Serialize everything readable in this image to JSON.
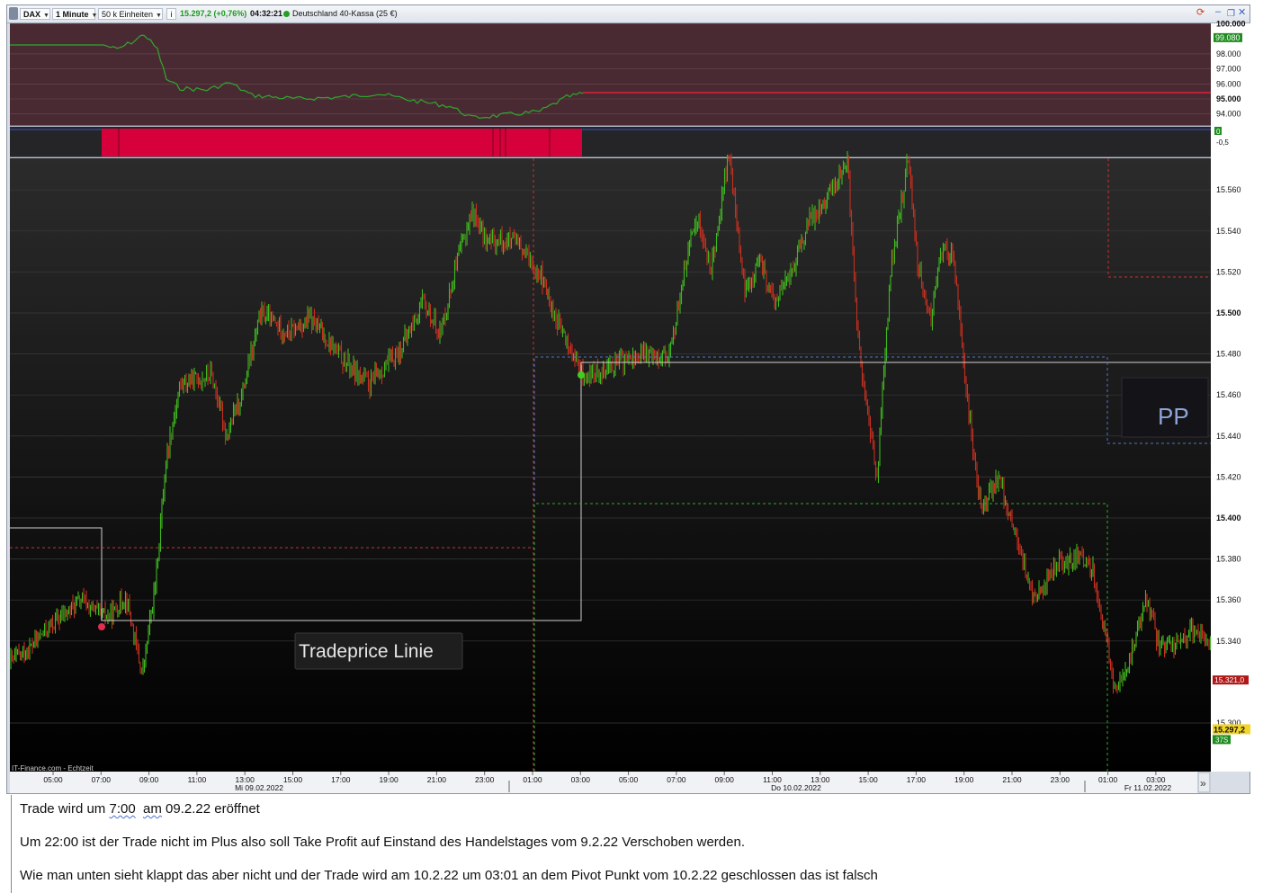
{
  "toolbar": {
    "instrument": "DAX",
    "timeframe": "1 Minute",
    "units": "50 k Einheiten",
    "price_change": "15.297,2 (+0,76%)",
    "time": "04:32:21",
    "market_name": "Deutschland 40-Kassa (25 €)"
  },
  "top_panel": {
    "ticks": [
      "100.000",
      "98.000",
      "97.000",
      "96.000",
      "95.000",
      "94.000"
    ],
    "current_label": "99.080",
    "colors": {
      "background": "#4a2a32",
      "line_flat": "#2ea82e",
      "line_level": "#e0203a",
      "current_label_bg": "#1e8c1e"
    }
  },
  "signal_panel": {
    "ticks": [
      "0",
      "-0,5"
    ],
    "colors": {
      "bar": "#d6003a",
      "line": "#3b4fd8"
    }
  },
  "main_chart": {
    "price_ticks": [
      "15.560",
      "15.540",
      "15.520",
      "15.500",
      "15.480",
      "15.460",
      "15.440",
      "15.420",
      "15.400",
      "15.380",
      "15.360",
      "15.340",
      "15.300"
    ],
    "bold_ticks": [
      "15.500",
      "15.400"
    ],
    "price_markers": {
      "red": "15.321,0",
      "current": "15.297,2",
      "countdown": "37S"
    },
    "time_labels": [
      "05:00",
      "07:00",
      "09:00",
      "11:00",
      "13:00",
      "15:00",
      "17:00",
      "19:00",
      "21:00",
      "23:00",
      "01:00",
      "03:00",
      "05:00",
      "07:00",
      "09:00",
      "11:00",
      "13:00",
      "15:00",
      "17:00",
      "19:00",
      "21:00",
      "23:00",
      "01:00",
      "03:00"
    ],
    "date_labels": [
      "Mi 09.02.2022",
      "Do 10.02.2022",
      "Fr 11.02.2022"
    ],
    "source_label": "IT-Finance.com - Echtzeit",
    "annotation_tradeprice": "Tradeprice Linie",
    "annotation_pp": "PP",
    "scroll_button": "»",
    "colors": {
      "background_top": "#2a2a2a",
      "background_bottom": "#000000",
      "candle_up": "#3fb81e",
      "candle_down": "#c43020",
      "red_dashed": "#c83232",
      "blue_dashed": "#4a78c8",
      "green_dashed": "#2ea82e",
      "white_line": "#d0d0d0"
    }
  },
  "notes": {
    "line1_a": "Trade wird um ",
    "line1_b": "7:00",
    "line1_c": "  ",
    "line1_d": "am",
    "line1_e": " 09.2.22 eröffnet",
    "line2": "Um 22:00 ist der Trade nicht im Plus also soll Take Profit auf Einstand des Handelstages vom 9.2.22 Verschoben werden.",
    "line3": "Wie man unten sieht klappt das aber nicht und der Trade wird am 10.2.22 um 03:01 an dem Pivot Punkt vom 10.2.22 geschlossen das ist falsch"
  }
}
